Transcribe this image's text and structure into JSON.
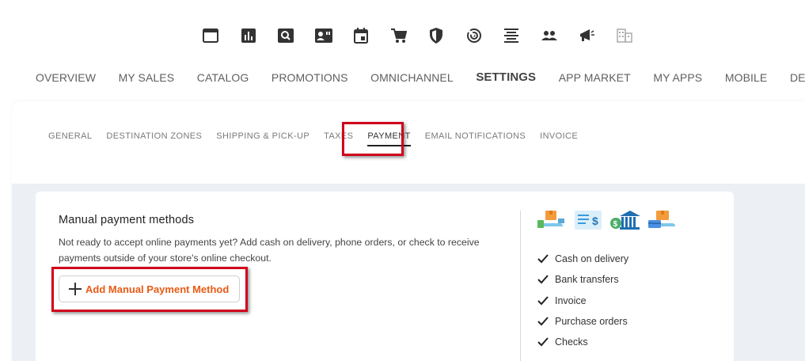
{
  "top_icons": [
    {
      "name": "overview-icon"
    },
    {
      "name": "sales-chart-icon"
    },
    {
      "name": "catalog-search-icon"
    },
    {
      "name": "reviews-icon"
    },
    {
      "name": "calendar-icon"
    },
    {
      "name": "cart-icon"
    },
    {
      "name": "shield-icon"
    },
    {
      "name": "radar-icon"
    },
    {
      "name": "align-icon"
    },
    {
      "name": "people-icon"
    },
    {
      "name": "megaphone-icon"
    },
    {
      "name": "building-icon"
    }
  ],
  "main_nav": [
    {
      "label": "OVERVIEW",
      "active": false
    },
    {
      "label": "MY SALES",
      "active": false
    },
    {
      "label": "CATALOG",
      "active": false
    },
    {
      "label": "PROMOTIONS",
      "active": false
    },
    {
      "label": "OMNICHANNEL",
      "active": false
    },
    {
      "label": "SETTINGS",
      "active": true
    },
    {
      "label": "APP MARKET",
      "active": false
    },
    {
      "label": "MY APPS",
      "active": false
    },
    {
      "label": "MOBILE",
      "active": false
    },
    {
      "label": "DESIGN",
      "active": false
    }
  ],
  "settings_tabs": [
    {
      "label": "GENERAL",
      "active": false
    },
    {
      "label": "DESTINATION ZONES",
      "active": false
    },
    {
      "label": "SHIPPING & PICK-UP",
      "active": false
    },
    {
      "label": "TAXES",
      "active": false
    },
    {
      "label": "PAYMENT",
      "active": true
    },
    {
      "label": "EMAIL NOTIFICATIONS",
      "active": false
    },
    {
      "label": "INVOICE",
      "active": false
    }
  ],
  "manual_payment": {
    "title": "Manual payment methods",
    "description": "Not ready to accept online payments yet? Add cash on delivery, phone orders, or check to receive payments outside of your store's online checkout.",
    "add_button_label": "Add Manual Payment Method",
    "features": [
      "Cash on delivery",
      "Bank transfers",
      "Invoice",
      "Purchase orders",
      "Checks"
    ],
    "illustrations": [
      "cash-delivery-icon",
      "invoice-dollar-icon",
      "bank-icon",
      "card-transfer-icon"
    ]
  },
  "colors": {
    "accent": "#ea5a14",
    "highlight": "#d0021b",
    "panel_bg": "#ecf0f4"
  }
}
